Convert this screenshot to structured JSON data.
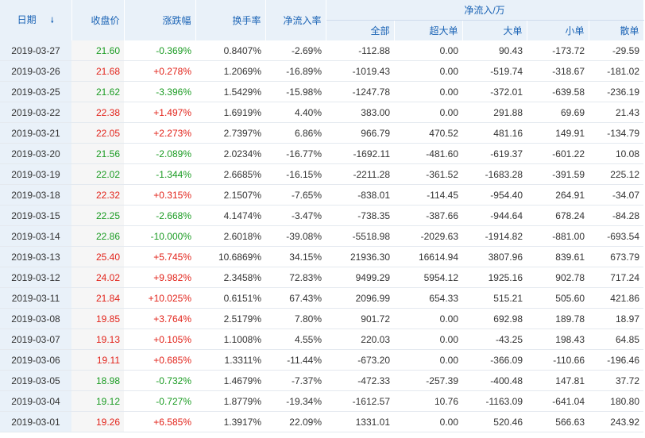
{
  "headers": {
    "date": "日期",
    "close": "收盘价",
    "change": "涨跌幅",
    "turnover": "换手率",
    "net_inflow_rate": "净流入率",
    "net_inflow_group": "净流入/万",
    "total": "全部",
    "super_large": "超大单",
    "large": "大单",
    "small": "小单",
    "retail": "散单"
  },
  "rows": [
    {
      "date": "2019-03-27",
      "close": "21.60",
      "change": "-0.369%",
      "turnover": "0.8407%",
      "rate": "-2.69%",
      "total": "-112.88",
      "super": "0.00",
      "large": "90.43",
      "small": "-173.72",
      "retail": "-29.59"
    },
    {
      "date": "2019-03-26",
      "close": "21.68",
      "change": "+0.278%",
      "turnover": "1.2069%",
      "rate": "-16.89%",
      "total": "-1019.43",
      "super": "0.00",
      "large": "-519.74",
      "small": "-318.67",
      "retail": "-181.02"
    },
    {
      "date": "2019-03-25",
      "close": "21.62",
      "change": "-3.396%",
      "turnover": "1.5429%",
      "rate": "-15.98%",
      "total": "-1247.78",
      "super": "0.00",
      "large": "-372.01",
      "small": "-639.58",
      "retail": "-236.19"
    },
    {
      "date": "2019-03-22",
      "close": "22.38",
      "change": "+1.497%",
      "turnover": "1.6919%",
      "rate": "4.40%",
      "total": "383.00",
      "super": "0.00",
      "large": "291.88",
      "small": "69.69",
      "retail": "21.43"
    },
    {
      "date": "2019-03-21",
      "close": "22.05",
      "change": "+2.273%",
      "turnover": "2.7397%",
      "rate": "6.86%",
      "total": "966.79",
      "super": "470.52",
      "large": "481.16",
      "small": "149.91",
      "retail": "-134.79"
    },
    {
      "date": "2019-03-20",
      "close": "21.56",
      "change": "-2.089%",
      "turnover": "2.0234%",
      "rate": "-16.77%",
      "total": "-1692.11",
      "super": "-481.60",
      "large": "-619.37",
      "small": "-601.22",
      "retail": "10.08"
    },
    {
      "date": "2019-03-19",
      "close": "22.02",
      "change": "-1.344%",
      "turnover": "2.6685%",
      "rate": "-16.15%",
      "total": "-2211.28",
      "super": "-361.52",
      "large": "-1683.28",
      "small": "-391.59",
      "retail": "225.12"
    },
    {
      "date": "2019-03-18",
      "close": "22.32",
      "change": "+0.315%",
      "turnover": "2.1507%",
      "rate": "-7.65%",
      "total": "-838.01",
      "super": "-114.45",
      "large": "-954.40",
      "small": "264.91",
      "retail": "-34.07"
    },
    {
      "date": "2019-03-15",
      "close": "22.25",
      "change": "-2.668%",
      "turnover": "4.1474%",
      "rate": "-3.47%",
      "total": "-738.35",
      "super": "-387.66",
      "large": "-944.64",
      "small": "678.24",
      "retail": "-84.28"
    },
    {
      "date": "2019-03-14",
      "close": "22.86",
      "change": "-10.000%",
      "turnover": "2.6018%",
      "rate": "-39.08%",
      "total": "-5518.98",
      "super": "-2029.63",
      "large": "-1914.82",
      "small": "-881.00",
      "retail": "-693.54"
    },
    {
      "date": "2019-03-13",
      "close": "25.40",
      "change": "+5.745%",
      "turnover": "10.6869%",
      "rate": "34.15%",
      "total": "21936.30",
      "super": "16614.94",
      "large": "3807.96",
      "small": "839.61",
      "retail": "673.79"
    },
    {
      "date": "2019-03-12",
      "close": "24.02",
      "change": "+9.982%",
      "turnover": "2.3458%",
      "rate": "72.83%",
      "total": "9499.29",
      "super": "5954.12",
      "large": "1925.16",
      "small": "902.78",
      "retail": "717.24"
    },
    {
      "date": "2019-03-11",
      "close": "21.84",
      "change": "+10.025%",
      "turnover": "0.6151%",
      "rate": "67.43%",
      "total": "2096.99",
      "super": "654.33",
      "large": "515.21",
      "small": "505.60",
      "retail": "421.86"
    },
    {
      "date": "2019-03-08",
      "close": "19.85",
      "change": "+3.764%",
      "turnover": "2.5179%",
      "rate": "7.80%",
      "total": "901.72",
      "super": "0.00",
      "large": "692.98",
      "small": "189.78",
      "retail": "18.97"
    },
    {
      "date": "2019-03-07",
      "close": "19.13",
      "change": "+0.105%",
      "turnover": "1.1008%",
      "rate": "4.55%",
      "total": "220.03",
      "super": "0.00",
      "large": "-43.25",
      "small": "198.43",
      "retail": "64.85"
    },
    {
      "date": "2019-03-06",
      "close": "19.11",
      "change": "+0.685%",
      "turnover": "1.3311%",
      "rate": "-11.44%",
      "total": "-673.20",
      "super": "0.00",
      "large": "-366.09",
      "small": "-110.66",
      "retail": "-196.46"
    },
    {
      "date": "2019-03-05",
      "close": "18.98",
      "change": "-0.732%",
      "turnover": "1.4679%",
      "rate": "-7.37%",
      "total": "-472.33",
      "super": "-257.39",
      "large": "-400.48",
      "small": "147.81",
      "retail": "37.72"
    },
    {
      "date": "2019-03-04",
      "close": "19.12",
      "change": "-0.727%",
      "turnover": "1.8779%",
      "rate": "-19.34%",
      "total": "-1612.57",
      "super": "10.76",
      "large": "-1163.09",
      "small": "-641.04",
      "retail": "180.80"
    },
    {
      "date": "2019-03-01",
      "close": "19.26",
      "change": "+6.585%",
      "turnover": "1.3917%",
      "rate": "22.09%",
      "total": "1331.01",
      "super": "0.00",
      "large": "520.46",
      "small": "566.63",
      "retail": "243.92"
    }
  ]
}
